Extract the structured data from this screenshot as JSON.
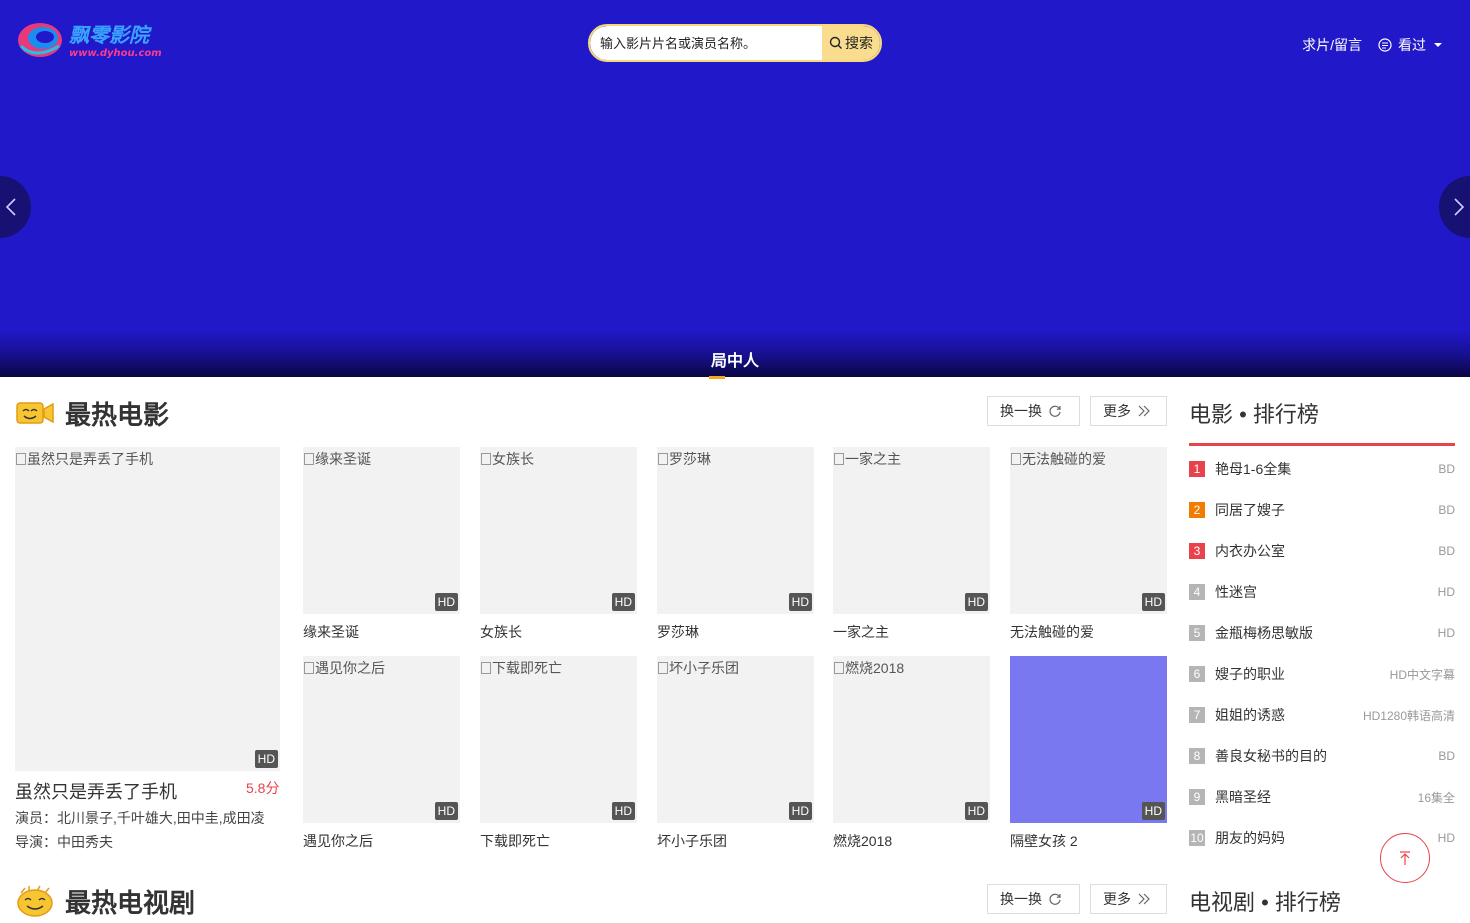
{
  "header": {
    "logo_text": "飘零影院",
    "logo_url": "www.dyhou.com",
    "search_placeholder": "输入影片片名或演员名称。",
    "search_button": "搜索",
    "nav_request": "求片/留言",
    "nav_watched": "看过"
  },
  "banner": {
    "caption": "局中人",
    "bg_color": "#2118c9"
  },
  "hot_movies": {
    "title": "最热电影",
    "change_label": "换一换",
    "more_label": "更多",
    "featured": {
      "alt": "虽然只是弄丢了手机",
      "badge": "HD",
      "title": "虽然只是弄丢了手机",
      "score": "5.8分",
      "actors": "演员：北川景子,千叶雄大,田中圭,成田凌",
      "director": "导演：中田秀夫"
    },
    "items": [
      {
        "alt": "缘来圣诞",
        "title": "缘来圣诞",
        "badge": "HD"
      },
      {
        "alt": "女族长",
        "title": "女族长",
        "badge": "HD"
      },
      {
        "alt": "罗莎琳",
        "title": "罗莎琳",
        "badge": "HD"
      },
      {
        "alt": "一家之主",
        "title": "一家之主",
        "badge": "HD"
      },
      {
        "alt": "无法触碰的爱",
        "title": "无法触碰的爱",
        "badge": "HD"
      },
      {
        "alt": "遇见你之后",
        "title": "遇见你之后",
        "badge": "HD"
      },
      {
        "alt": "下载即死亡",
        "title": "下载即死亡",
        "badge": "HD"
      },
      {
        "alt": "坏小子乐团",
        "title": "坏小子乐团",
        "badge": "HD"
      },
      {
        "alt": "燃烧2018",
        "title": "燃烧2018",
        "badge": "HD"
      },
      {
        "alt": "",
        "title": "隔壁女孩 2",
        "badge": "HD"
      }
    ]
  },
  "movie_ranking": {
    "title": "电影 • 排行榜",
    "items": [
      {
        "num": "1",
        "name": "艳母1-6全集",
        "tag": "BD",
        "color": "#e8434d"
      },
      {
        "num": "2",
        "name": "同居了嫂子",
        "tag": "BD",
        "color": "#f07c00"
      },
      {
        "num": "3",
        "name": "内衣办公室",
        "tag": "BD",
        "color": "#e8434d"
      },
      {
        "num": "4",
        "name": "性迷宫",
        "tag": "HD",
        "color": "#b5b5b5"
      },
      {
        "num": "5",
        "name": "金瓶梅杨思敏版",
        "tag": "HD",
        "color": "#b5b5b5"
      },
      {
        "num": "6",
        "name": "嫂子的职业",
        "tag": "HD中文字幕",
        "color": "#b5b5b5"
      },
      {
        "num": "7",
        "name": "姐姐的诱惑",
        "tag": "HD1280韩语高清",
        "color": "#b5b5b5"
      },
      {
        "num": "8",
        "name": "善良女秘书的目的",
        "tag": "BD",
        "color": "#b5b5b5"
      },
      {
        "num": "9",
        "name": "黑暗圣经",
        "tag": "16集全",
        "color": "#b5b5b5"
      },
      {
        "num": "10",
        "name": "朋友的妈妈",
        "tag": "HD",
        "color": "#b5b5b5"
      }
    ]
  },
  "hot_tv": {
    "title": "最热电视剧",
    "change_label": "换一换",
    "more_label": "更多"
  },
  "tv_ranking": {
    "title": "电视剧 • 排行榜"
  }
}
